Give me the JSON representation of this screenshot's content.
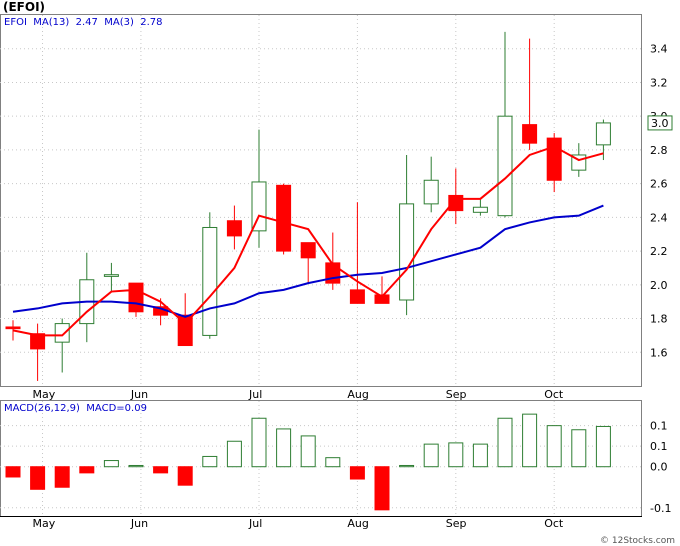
{
  "header": {
    "title": "(EFOI)",
    "legend_price": "EFOI  MA(13)  2.47  MA(3)  2.78",
    "legend_macd": "MACD(26,12,9)  MACD=0.09",
    "price_badge": "3.0",
    "watermark": "© 12Stocks.com"
  },
  "colors": {
    "up": "#2e7d32",
    "down": "#ff0000",
    "ma13": "#0000cc",
    "ma3": "#ff0000",
    "badge": "#2e7d32"
  },
  "chart_data": [
    {
      "type": "candlestick",
      "title": "(EFOI)",
      "ylim": [
        1.4,
        3.6
      ],
      "yticks": [
        "1.6",
        "1.8",
        "2.0",
        "2.2",
        "2.4",
        "2.6",
        "2.8",
        "3.0",
        "3.2",
        "3.4"
      ],
      "ytick_values": [
        1.6,
        1.8,
        2.0,
        2.2,
        2.4,
        2.6,
        2.8,
        3.0,
        3.2,
        3.4
      ],
      "xlabels": [
        "May",
        "Jun",
        "Jul",
        "Aug",
        "Sep",
        "Oct"
      ],
      "xlabel_index": [
        1.2,
        5.2,
        10.0,
        14.0,
        18.0,
        22.0
      ],
      "candles": [
        {
          "o": 1.75,
          "h": 1.79,
          "l": 1.67,
          "c": 1.74
        },
        {
          "o": 1.71,
          "h": 1.77,
          "l": 1.43,
          "c": 1.62
        },
        {
          "o": 1.66,
          "h": 1.8,
          "l": 1.48,
          "c": 1.77
        },
        {
          "o": 1.77,
          "h": 2.19,
          "l": 1.66,
          "c": 2.03
        },
        {
          "o": 2.05,
          "h": 2.13,
          "l": 1.96,
          "c": 2.06
        },
        {
          "o": 2.01,
          "h": 2.01,
          "l": 1.81,
          "c": 1.84
        },
        {
          "o": 1.87,
          "h": 1.92,
          "l": 1.76,
          "c": 1.82
        },
        {
          "o": 1.82,
          "h": 1.95,
          "l": 1.66,
          "c": 1.64
        },
        {
          "o": 1.7,
          "h": 2.43,
          "l": 1.68,
          "c": 2.34
        },
        {
          "o": 2.38,
          "h": 2.47,
          "l": 2.21,
          "c": 2.29
        },
        {
          "o": 2.32,
          "h": 2.92,
          "l": 2.22,
          "c": 2.61
        },
        {
          "o": 2.59,
          "h": 2.6,
          "l": 2.18,
          "c": 2.2
        },
        {
          "o": 2.25,
          "h": 2.25,
          "l": 2.01,
          "c": 2.16
        },
        {
          "o": 2.13,
          "h": 2.31,
          "l": 1.97,
          "c": 2.01
        },
        {
          "o": 1.97,
          "h": 2.49,
          "l": 1.92,
          "c": 1.89
        },
        {
          "o": 1.94,
          "h": 2.05,
          "l": 1.89,
          "c": 1.89
        },
        {
          "o": 1.91,
          "h": 2.77,
          "l": 1.82,
          "c": 2.48
        },
        {
          "o": 2.48,
          "h": 2.76,
          "l": 2.43,
          "c": 2.62
        },
        {
          "o": 2.53,
          "h": 2.69,
          "l": 2.36,
          "c": 2.44
        },
        {
          "o": 2.43,
          "h": 2.51,
          "l": 2.41,
          "c": 2.46
        },
        {
          "o": 2.41,
          "h": 3.5,
          "l": 2.4,
          "c": 3.0
        },
        {
          "o": 2.95,
          "h": 3.46,
          "l": 2.8,
          "c": 2.84
        },
        {
          "o": 2.87,
          "h": 2.9,
          "l": 2.55,
          "c": 2.62
        },
        {
          "o": 2.68,
          "h": 2.84,
          "l": 2.64,
          "c": 2.77
        },
        {
          "o": 2.83,
          "h": 2.98,
          "l": 2.74,
          "c": 2.96
        }
      ],
      "series": [
        {
          "name": "MA(13)",
          "values": [
            1.84,
            1.86,
            1.89,
            1.9,
            1.9,
            1.89,
            1.86,
            1.81,
            1.86,
            1.89,
            1.95,
            1.97,
            2.01,
            2.04,
            2.06,
            2.07,
            2.1,
            2.14,
            2.18,
            2.22,
            2.33,
            2.37,
            2.4,
            2.41,
            2.47
          ]
        },
        {
          "name": "MA(3)",
          "values": [
            1.73,
            1.7,
            1.7,
            1.84,
            1.96,
            1.97,
            1.9,
            1.77,
            1.93,
            2.1,
            2.41,
            2.37,
            2.33,
            2.12,
            2.02,
            1.93,
            2.09,
            2.33,
            2.51,
            2.51,
            2.63,
            2.77,
            2.82,
            2.74,
            2.78
          ]
        }
      ]
    },
    {
      "type": "bar",
      "title": "MACD(26,12,9)",
      "ylim": [
        -0.12,
        0.16
      ],
      "yticks": [
        "-0.1",
        "0.0",
        "0.1",
        "0.1"
      ],
      "ytick_values": [
        -0.1,
        0.0,
        0.05,
        0.1
      ],
      "xlabels": [
        "May",
        "Jun",
        "Jul",
        "Aug",
        "Sep",
        "Oct"
      ],
      "xlabel_index": [
        1.2,
        5.2,
        10.0,
        14.0,
        18.0,
        22.0
      ],
      "values": [
        -0.025,
        -0.055,
        -0.05,
        -0.015,
        0.015,
        0.003,
        -0.015,
        -0.045,
        0.025,
        0.062,
        0.118,
        0.092,
        0.075,
        0.022,
        -0.03,
        -0.105,
        0.003,
        0.055,
        0.058,
        0.055,
        0.118,
        0.128,
        0.1,
        0.09,
        0.098
      ]
    }
  ]
}
